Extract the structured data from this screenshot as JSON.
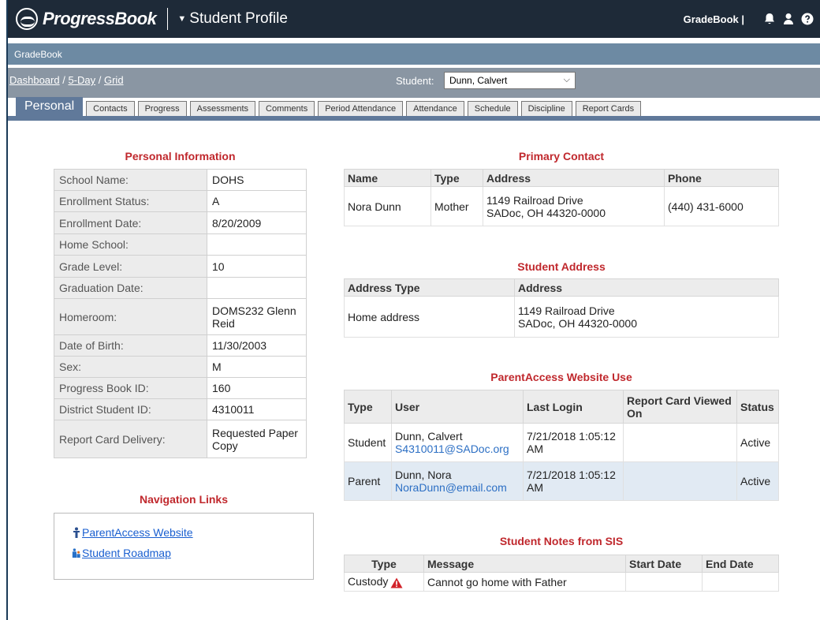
{
  "topbar": {
    "brand": "ProgressBook",
    "app_title": "Student Profile",
    "gradebook_label": "GradeBook |"
  },
  "subbar": {
    "label": "GradeBook"
  },
  "breadcrumb": {
    "items": [
      "Dashboard",
      "5-Day",
      "Grid"
    ],
    "separator": " / "
  },
  "student": {
    "label": "Student:",
    "selected": "Dunn, Calvert"
  },
  "tabs": [
    "Personal",
    "Contacts",
    "Progress",
    "Assessments",
    "Comments",
    "Period Attendance",
    "Attendance",
    "Schedule",
    "Discipline",
    "Report Cards"
  ],
  "personal": {
    "title": "Personal Information",
    "rows": [
      {
        "key": "School Name:",
        "value": "DOHS"
      },
      {
        "key": "Enrollment Status:",
        "value": "A"
      },
      {
        "key": "Enrollment Date:",
        "value": "8/20/2009"
      },
      {
        "key": "Home School:",
        "value": ""
      },
      {
        "key": "Grade Level:",
        "value": "10"
      },
      {
        "key": "Graduation Date:",
        "value": ""
      },
      {
        "key": "Homeroom:",
        "value": "DOMS232 Glenn Reid"
      },
      {
        "key": "Date of Birth:",
        "value": "11/30/2003"
      },
      {
        "key": "Sex:",
        "value": "M"
      },
      {
        "key": "Progress Book ID:",
        "value": "160"
      },
      {
        "key": "District Student ID:",
        "value": "4310011"
      },
      {
        "key": "Report Card Delivery:",
        "value": "Requested Paper Copy"
      }
    ]
  },
  "nav_links": {
    "title": "Navigation Links",
    "parent_access": "ParentAccess Website",
    "roadmap": "Student Roadmap"
  },
  "primary_contact": {
    "title": "Primary Contact",
    "headers": [
      "Name",
      "Type",
      "Address",
      "Phone"
    ],
    "row": {
      "name": "Nora Dunn",
      "type": "Mother",
      "address_line1": "1149 Railroad Drive",
      "address_line2": "SADoc, OH 44320-0000",
      "phone": "(440) 431-6000"
    }
  },
  "student_address": {
    "title": "Student Address",
    "headers": [
      "Address Type",
      "Address"
    ],
    "row": {
      "type": "Home address",
      "address_line1": "1149 Railroad Drive",
      "address_line2": "SADoc, OH 44320-0000"
    }
  },
  "parent_access": {
    "title": "ParentAccess Website Use",
    "headers": [
      "Type",
      "User",
      "Last Login",
      "Report Card Viewed On",
      "Status"
    ],
    "rows": [
      {
        "type": "Student",
        "user": "Dunn, Calvert",
        "email": "S4310011@SADoc.org",
        "login1": "7/21/2018 1:05:12",
        "login2": "AM",
        "viewed": "",
        "status": "Active"
      },
      {
        "type": "Parent",
        "user": "Dunn, Nora",
        "email": "NoraDunn@email.com",
        "login1": "7/21/2018 1:05:12",
        "login2": "AM",
        "viewed": "",
        "status": "Active"
      }
    ]
  },
  "notes": {
    "title": "Student Notes from SIS",
    "headers": [
      "Type",
      "Message",
      "Start Date",
      "End Date"
    ],
    "row": {
      "type": "Custody",
      "message": "Cannot go home with Father",
      "start": "",
      "end": ""
    }
  }
}
